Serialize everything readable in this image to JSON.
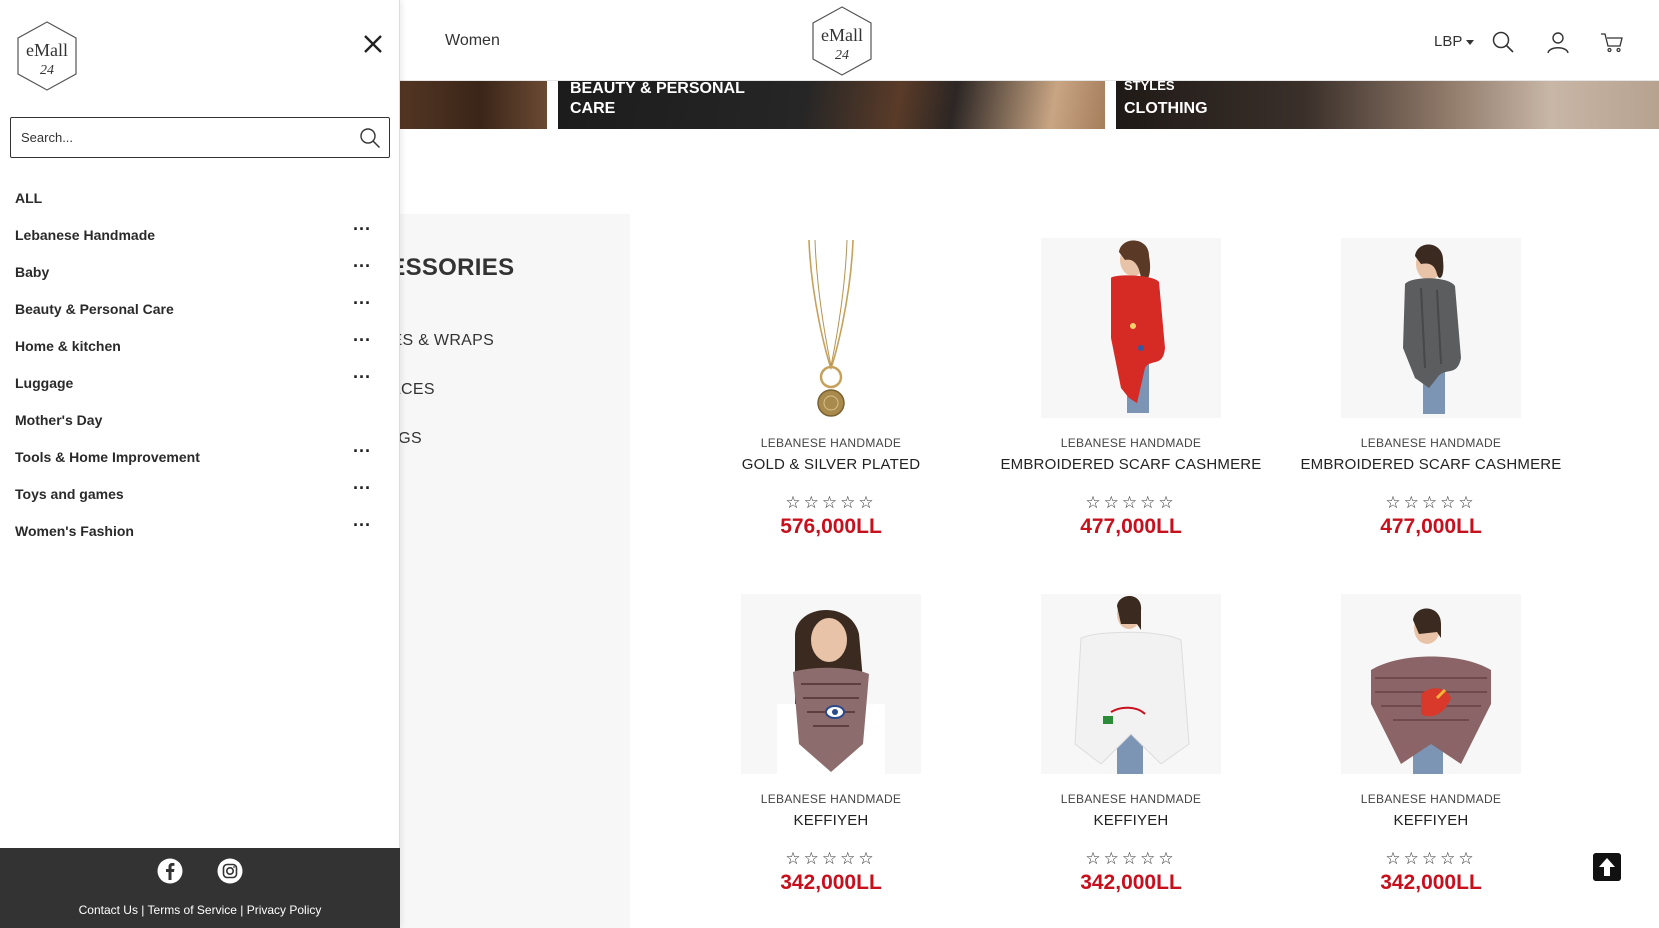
{
  "header": {
    "nav_women": "Women",
    "logo_text": "eMall",
    "logo_number": "24",
    "currency": "LBP"
  },
  "banners": [
    {
      "label": ""
    },
    {
      "label": "BEAUTY & PERSONAL CARE"
    },
    {
      "label": "CLOTHING",
      "small": "STYLES"
    }
  ],
  "category_panel": {
    "title": "CCESSORIES",
    "links": [
      "ARVES & WRAPS",
      "CKLACES",
      "RRINGS"
    ]
  },
  "products": [
    {
      "brand": "LEBANESE HANDMADE",
      "name": "GOLD & SILVER PLATED",
      "stars": "☆☆☆☆☆",
      "price": "576,000LL",
      "image": "necklace"
    },
    {
      "brand": "LEBANESE HANDMADE",
      "name": "EMBROIDERED SCARF CASHMERE",
      "stars": "☆☆☆☆☆",
      "price": "477,000LL",
      "image": "red-scarf"
    },
    {
      "brand": "LEBANESE HANDMADE",
      "name": "EMBROIDERED SCARF CASHMERE",
      "stars": "☆☆☆☆☆",
      "price": "477,000LL",
      "image": "grey-scarf"
    },
    {
      "brand": "LEBANESE HANDMADE",
      "name": "KEFFIYEH",
      "stars": "☆☆☆☆☆",
      "price": "342,000LL",
      "image": "keffiyeh-eye"
    },
    {
      "brand": "LEBANESE HANDMADE",
      "name": "KEFFIYEH",
      "stars": "☆☆☆☆☆",
      "price": "342,000LL",
      "image": "keffiyeh-white"
    },
    {
      "brand": "LEBANESE HANDMADE",
      "name": "KEFFIYEH",
      "stars": "☆☆☆☆☆",
      "price": "342,000LL",
      "image": "keffiyeh-red"
    }
  ],
  "drawer": {
    "logo_text": "eMall",
    "logo_number": "24",
    "search_placeholder": "Search...",
    "menu": [
      {
        "label": "ALL",
        "has_more": false
      },
      {
        "label": "Lebanese Handmade",
        "has_more": true
      },
      {
        "label": "Baby",
        "has_more": true
      },
      {
        "label": "Beauty & Personal Care",
        "has_more": true
      },
      {
        "label": "Home & kitchen",
        "has_more": true
      },
      {
        "label": "Luggage",
        "has_more": true
      },
      {
        "label": "Mother's Day",
        "has_more": false
      },
      {
        "label": "Tools & Home Improvement",
        "has_more": true
      },
      {
        "label": "Toys and games",
        "has_more": true
      },
      {
        "label": "Women's Fashion",
        "has_more": true
      }
    ],
    "more_glyph": "···",
    "footer": {
      "contact": "Contact Us",
      "terms": "Terms of Service",
      "privacy": "Privacy Policy",
      "separator": " | "
    }
  },
  "icons": {
    "search": "search-icon",
    "account": "user-icon",
    "cart": "cart-icon",
    "close": "close-icon",
    "facebook": "facebook-icon",
    "instagram": "instagram-icon",
    "back_to_top": "arrow-up-icon"
  },
  "colors": {
    "price": "#c8101d",
    "footer_bg": "#333333",
    "back_to_top": "#111111"
  }
}
